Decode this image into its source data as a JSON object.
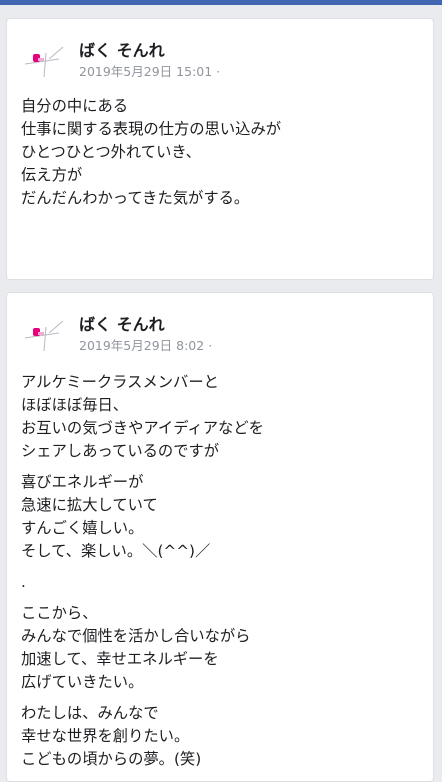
{
  "posts": [
    {
      "author": "ばく そんれ",
      "timestamp": "2019年5月29日 15:01",
      "privacy_separator": "·",
      "paragraphs": [
        [
          "自分の中にある",
          "仕事に関する表現の仕方の思い込みが",
          "ひとつひとつ外れていき、",
          "伝え方が",
          "だんだんわかってきた気がする。"
        ]
      ]
    },
    {
      "author": "ばく そんれ",
      "timestamp": "2019年5月29日 8:02",
      "privacy_separator": "·",
      "paragraphs": [
        [
          "アルケミークラスメンバーと",
          "ほぼほぼ毎日、",
          "お互いの気づきやアイディアなどを",
          "シェアしあっているのですが"
        ],
        [
          "喜びエネルギーが",
          "急速に拡大していて",
          "すんごく嬉しい。",
          "そして、楽しい。＼(^^)／"
        ],
        [
          "."
        ],
        [
          "ここから、",
          "みんなで個性を活かし合いながら",
          "加速して、幸せエネルギーを",
          "広げていきたい。"
        ],
        [
          "わたしは、みんなで",
          "幸せな世界を創りたい。",
          "こどもの頃からの夢。(笑)"
        ]
      ]
    }
  ]
}
